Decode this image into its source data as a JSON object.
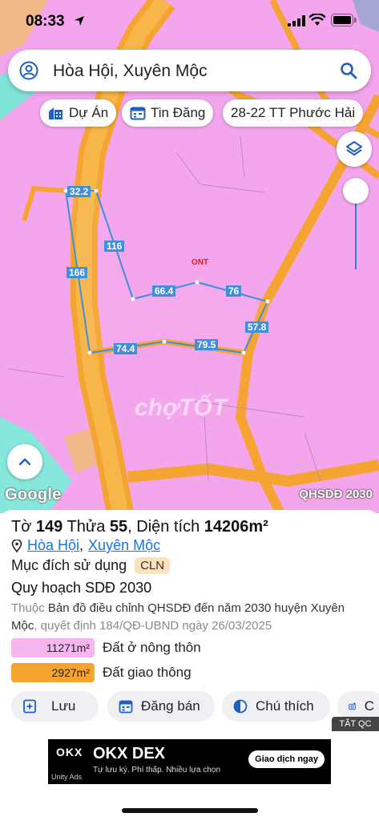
{
  "status_bar": {
    "time": "08:33"
  },
  "search": {
    "query": "Hòa Hội, Xuyên Mộc"
  },
  "chips": {
    "project": "Dự Án",
    "listings": "Tin Đăng",
    "parcel": "28-22 TT Phước Hải"
  },
  "map": {
    "labels": {
      "zone": "ONT",
      "layer": "QHSDĐ 2030",
      "google": "Google",
      "watermark": "chợTỐT"
    },
    "edges": [
      "32.2",
      "116",
      "166",
      "66.4",
      "76",
      "57.8",
      "74.4",
      "79.5"
    ]
  },
  "parcel": {
    "sheet_label": "Tờ",
    "sheet": "149",
    "plot_label": "Thửa",
    "plot": "55",
    "area_label": "Diện tích",
    "area": "14206m²",
    "commune": "Hòa Hội",
    "district": "Xuyên Mộc",
    "purpose_label": "Mục đích sử dụng",
    "purpose_code": "CLN",
    "plan": "Quy hoạch SDĐ 2030",
    "desc_prefix": "Thuộc",
    "desc_main": "Bản đồ điều chỉnh QHSDĐ đến năm 2030 huyện Xuyên Mộc",
    "desc_suffix": ", quyết định 184/QĐ-UBND ngày 26/03/2025"
  },
  "legend": [
    {
      "area": "11271m²",
      "label": "Đất ở nông thôn",
      "color": "#f7b5f0"
    },
    {
      "area": "2927m²",
      "label": "Đất giao thông",
      "color": "#f5a431"
    }
  ],
  "actions": {
    "save": "Lưu",
    "post": "Đăng bán",
    "notes": "Chú thích",
    "camera": "C"
  },
  "ad": {
    "close": "TẮT QC",
    "brand": "OKX",
    "title": "OKX DEX",
    "subtitle": "Tự lưu ký. Phí thấp. Nhiều lựa chọn",
    "cta": "Giao dịch ngay",
    "network": "Unity Ads"
  }
}
